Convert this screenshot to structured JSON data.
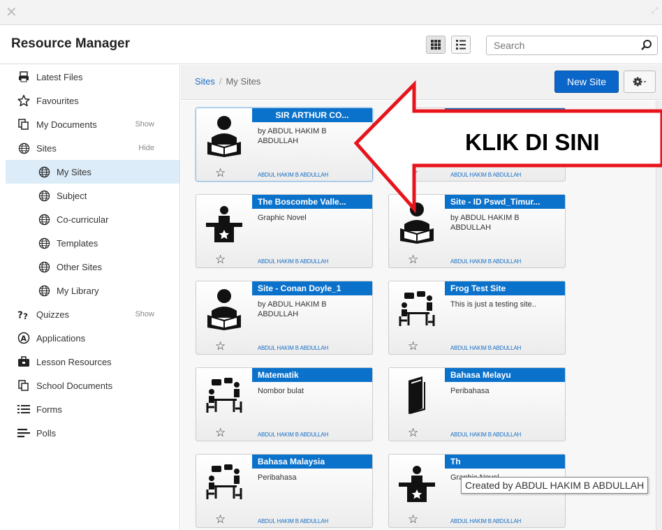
{
  "window": {
    "title": "Resource Manager"
  },
  "search": {
    "placeholder": "Search"
  },
  "sidebar": {
    "items": [
      {
        "label": "Latest Files",
        "icon": "printer-icon",
        "action": ""
      },
      {
        "label": "Favourites",
        "icon": "star-icon",
        "action": ""
      },
      {
        "label": "My Documents",
        "icon": "documents-icon",
        "action": "Show"
      },
      {
        "label": "Sites",
        "icon": "globe-icon",
        "action": "Hide"
      },
      {
        "label": "My Sites",
        "icon": "globe-icon",
        "action": "",
        "sub": true,
        "active": true
      },
      {
        "label": "Subject",
        "icon": "globe-icon",
        "action": "",
        "sub": true
      },
      {
        "label": "Co-curricular",
        "icon": "globe-icon",
        "action": "",
        "sub": true
      },
      {
        "label": "Templates",
        "icon": "globe-icon",
        "action": "",
        "sub": true
      },
      {
        "label": "Other Sites",
        "icon": "globe-icon",
        "action": "",
        "sub": true
      },
      {
        "label": "My Library",
        "icon": "globe-icon",
        "action": "",
        "sub": true
      },
      {
        "label": "Quizzes",
        "icon": "quiz-icon",
        "action": "Show"
      },
      {
        "label": "Applications",
        "icon": "applications-icon",
        "action": ""
      },
      {
        "label": "Lesson Resources",
        "icon": "briefcase-icon",
        "action": ""
      },
      {
        "label": "School Documents",
        "icon": "documents-icon",
        "action": ""
      },
      {
        "label": "Forms",
        "icon": "list-icon",
        "action": ""
      },
      {
        "label": "Polls",
        "icon": "poll-icon",
        "action": ""
      }
    ]
  },
  "breadcrumb": {
    "root": "Sites",
    "separator": "/",
    "current": "My Sites"
  },
  "toolbar": {
    "new_site": "New Site"
  },
  "cards": [
    {
      "title": "SIR ARTHUR CO...",
      "desc": "by ABDUL HAKIM B ABDULLAH",
      "owner": "ABDUL HAKIM B ABDULLAH",
      "icon": "reader-icon",
      "title_align": "center"
    },
    {
      "title": "",
      "desc": "",
      "owner": "ABDUL HAKIM B ABDULLAH",
      "icon": "reader-icon"
    },
    {
      "title": "The Boscombe Valle...",
      "desc": "Graphic Novel",
      "owner": "ABDUL HAKIM B ABDULLAH",
      "icon": "teacher-desk-icon"
    },
    {
      "title": "Site - ID Pswd_Timur...",
      "desc": "by ABDUL HAKIM B ABDULLAH",
      "owner": "ABDUL HAKIM B ABDULLAH",
      "icon": "reader-icon"
    },
    {
      "title": "Site - Conan Doyle_1",
      "desc": "by ABDUL HAKIM B ABDULLAH",
      "owner": "ABDUL HAKIM B ABDULLAH",
      "icon": "reader-icon"
    },
    {
      "title": "Frog Test Site",
      "desc": "This is just a testing site..",
      "owner": "ABDUL HAKIM B ABDULLAH",
      "icon": "discussion-icon"
    },
    {
      "title": "Matematik",
      "desc": "Nombor bulat",
      "owner": "ABDUL HAKIM B ABDULLAH",
      "icon": "discussion-icon"
    },
    {
      "title": "Bahasa Melayu",
      "desc": "Peribahasa",
      "owner": "ABDUL HAKIM B ABDULLAH",
      "icon": "book-icon"
    },
    {
      "title": "Bahasa Malaysia",
      "desc": "Peribahasa",
      "owner": "ABDUL HAKIM B ABDULLAH",
      "icon": "discussion-icon"
    },
    {
      "title": "Th",
      "desc": "Graphic Novel",
      "owner": "ABDUL HAKIM B ABDULLAH",
      "icon": "teacher-desk-icon"
    }
  ],
  "annotation": {
    "text": "KLIK  DI SINI",
    "arrow_color": "#e8141b"
  },
  "tooltip": {
    "text": "Created by ABDUL HAKIM B ABDULLAH"
  },
  "colors": {
    "accent": "#0b72cc",
    "active_bg": "#dcecf8",
    "link": "#1a6fc4"
  }
}
